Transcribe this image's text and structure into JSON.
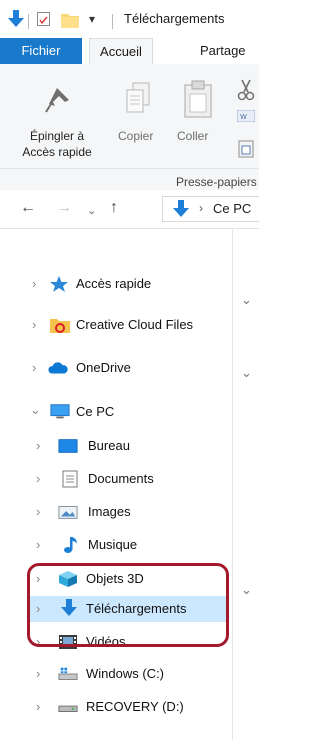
{
  "titlebar": {
    "title": "Téléchargements",
    "menu_glyph": "▾"
  },
  "ribbon": {
    "tabs": {
      "file": "Fichier",
      "home": "Accueil",
      "share": "Partage"
    },
    "pin": {
      "line1": "Épingler à",
      "line2": "Accès rapide"
    },
    "copy": "Copier",
    "paste": "Coller",
    "group_label": "Presse-papiers"
  },
  "address": {
    "location": "Ce PC"
  },
  "nav": {
    "quick_access": "Accès rapide",
    "creative_cloud": "Creative Cloud Files",
    "onedrive": "OneDrive",
    "this_pc": "Ce PC",
    "desktop": "Bureau",
    "documents": "Documents",
    "pictures": "Images",
    "music": "Musique",
    "objects3d": "Objets 3D",
    "downloads": "Téléchargements",
    "videos": "Vidéos",
    "drive_c": "Windows (C:)",
    "drive_d": "RECOVERY (D:)"
  },
  "colors": {
    "accent": "#1979ca",
    "selected": "#cce8ff",
    "highlight": "#a3182a",
    "folder_blue": "#1e7fd8"
  },
  "icons": [
    "down-arrow-icon",
    "checkbox-icon",
    "folder-icon",
    "pin-icon",
    "copy-icon",
    "paste-icon",
    "cut-icon",
    "back-arrow-icon",
    "forward-arrow-icon",
    "up-arrow-icon",
    "star-icon",
    "creative-cloud-icon",
    "cloud-icon",
    "computer-icon",
    "desktop-icon",
    "documents-icon",
    "pictures-icon",
    "music-icon",
    "cube-icon",
    "download-icon",
    "video-icon",
    "drive-icon"
  ]
}
